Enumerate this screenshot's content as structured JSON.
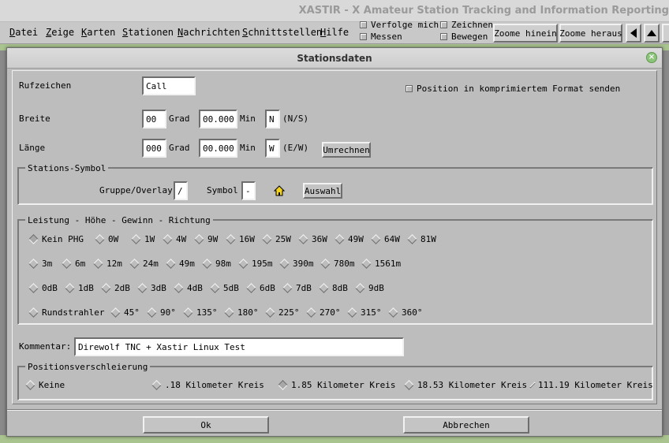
{
  "window": {
    "title": "XASTIR - X Amateur Station Tracking and Information Reporting"
  },
  "menubar": {
    "items": [
      "Datei",
      "Zeige",
      "Karten",
      "Stationen",
      "Nachrichten",
      "Schnittstellen",
      "Hilfe"
    ],
    "checks": [
      "Verfolge mich",
      "Messen",
      "Zeichnen",
      "Bewegen"
    ],
    "zoom_in": "Zoome hinein",
    "zoom_out": "Zoome heraus"
  },
  "dialog": {
    "title": "Stationsdaten",
    "callsign_label": "Rufzeichen",
    "callsign_value": "Call",
    "compressed_label": "Position in komprimiertem Format senden",
    "lat_label": "Breite",
    "lat_deg": "00",
    "lat_min": "00.000",
    "lat_dir": "N",
    "lat_dir_hint": "(N/S)",
    "lon_label": "Länge",
    "lon_deg": "000",
    "lon_min": "00.000",
    "lon_dir": "W",
    "lon_dir_hint": "(E/W)",
    "deg_unit": "Grad",
    "min_unit": "Min",
    "convert_button": "Umrechnen",
    "symbol_frame": "Stations-Symbol",
    "group_label": "Gruppe/Overlay",
    "group_value": "/",
    "symbol_label": "Symbol",
    "symbol_value": "-",
    "select_button": "Auswahl",
    "phg_frame": "Leistung - Höhe - Gewinn - Richtung",
    "power": [
      "Kein PHG",
      "0W",
      "1W",
      "4W",
      "9W",
      "16W",
      "25W",
      "36W",
      "49W",
      "64W",
      "81W"
    ],
    "height": [
      "3m",
      "6m",
      "12m",
      "24m",
      "49m",
      "98m",
      "195m",
      "390m",
      "780m",
      "1561m"
    ],
    "gain": [
      "0dB",
      "1dB",
      "2dB",
      "3dB",
      "4dB",
      "5dB",
      "6dB",
      "7dB",
      "8dB",
      "9dB"
    ],
    "direction": [
      "Rundstrahler",
      "45°",
      "90°",
      "135°",
      "180°",
      "225°",
      "270°",
      "315°",
      "360°"
    ],
    "comment_label": "Kommentar:",
    "comment_value": "Direwolf TNC + Xastir Linux Test",
    "ambiguity_frame": "Positionsverschleierung",
    "ambiguity": [
      "Keine",
      ".18 Kilometer Kreis",
      "1.85 Kilometer Kreis",
      "18.53 Kilometer Kreis",
      "111.19 Kilometer Kreis"
    ],
    "ok_button": "Ok",
    "cancel_button": "Abbrechen"
  }
}
